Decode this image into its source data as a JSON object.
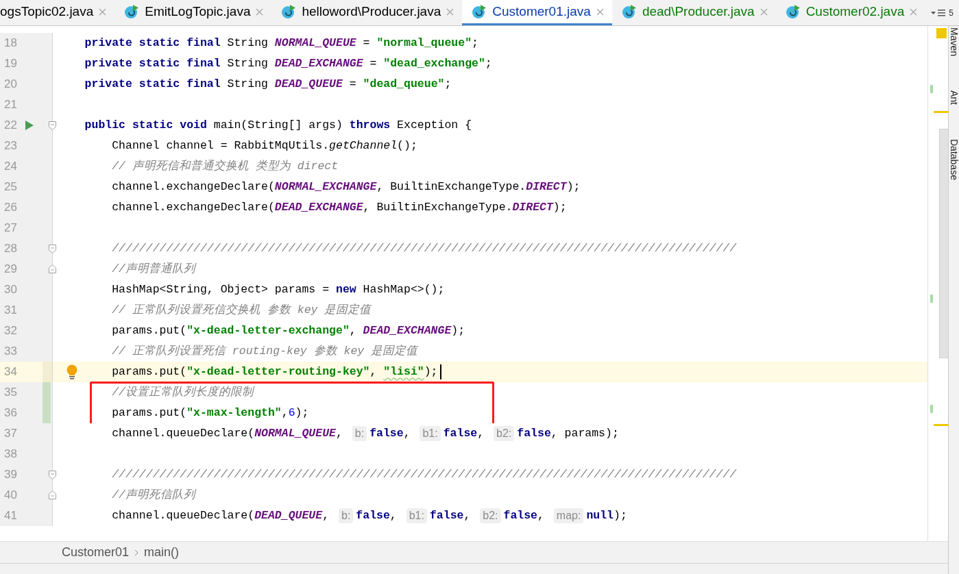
{
  "tabs": [
    {
      "label": "ogsTopic02.java",
      "selected": false,
      "has_icon": false,
      "color": "#000000"
    },
    {
      "label": "EmitLogTopic.java",
      "selected": false,
      "has_icon": true,
      "color": "#000000"
    },
    {
      "label": "helloword\\Producer.java",
      "selected": false,
      "has_icon": true,
      "color": "#000000"
    },
    {
      "label": "Customer01.java",
      "selected": true,
      "has_icon": true,
      "color": "#0b3aa8"
    },
    {
      "label": "dead\\Producer.java",
      "selected": false,
      "has_icon": true,
      "color": "#0a7a0a"
    },
    {
      "label": "Customer02.java",
      "selected": false,
      "has_icon": true,
      "color": "#0a7a0a"
    }
  ],
  "tab_overflow": "5",
  "lines": [
    {
      "number": "18",
      "current": false,
      "changed": false,
      "boxed": false,
      "tokens": [
        {
          "kind": "keyword",
          "text": "    private static final "
        },
        {
          "kind": "plain",
          "text": "String "
        },
        {
          "kind": "constant",
          "text": "NORMAL_QUEUE"
        },
        {
          "kind": "plain",
          "text": " = "
        },
        {
          "kind": "string",
          "text": "\"normal_queue\""
        },
        {
          "kind": "plain",
          "text": ";"
        }
      ]
    },
    {
      "number": "19",
      "current": false,
      "changed": false,
      "boxed": false,
      "tokens": [
        {
          "kind": "keyword",
          "text": "    private static final "
        },
        {
          "kind": "plain",
          "text": "String "
        },
        {
          "kind": "constant",
          "text": "DEAD_EXCHANGE"
        },
        {
          "kind": "plain",
          "text": " = "
        },
        {
          "kind": "string",
          "text": "\"dead_exchange\""
        },
        {
          "kind": "plain",
          "text": ";"
        }
      ]
    },
    {
      "number": "20",
      "current": false,
      "changed": false,
      "boxed": false,
      "tokens": [
        {
          "kind": "keyword",
          "text": "    private static final "
        },
        {
          "kind": "plain",
          "text": "String "
        },
        {
          "kind": "constant",
          "text": "DEAD_QUEUE"
        },
        {
          "kind": "plain",
          "text": " = "
        },
        {
          "kind": "string",
          "text": "\"dead_queue\""
        },
        {
          "kind": "plain",
          "text": ";"
        }
      ]
    },
    {
      "number": "21",
      "current": false,
      "changed": false,
      "boxed": false
    },
    {
      "number": "22",
      "gutter_icons": [
        {
          "kind": "run"
        },
        {
          "kind": "fold_start"
        }
      ],
      "current": false,
      "changed": false,
      "boxed": false,
      "tokens": [
        {
          "kind": "keyword",
          "text": "    public static void "
        },
        {
          "kind": "plain",
          "text": "main(String[] args) "
        },
        {
          "kind": "keyword",
          "text": "throws "
        },
        {
          "kind": "plain",
          "text": "Exception {"
        }
      ]
    },
    {
      "number": "23",
      "current": false,
      "changed": false,
      "boxed": false,
      "tokens": [
        {
          "kind": "plain",
          "text": "        Channel channel = RabbitMqUtils."
        },
        {
          "kind": "static_call",
          "text": "getChannel"
        },
        {
          "kind": "plain",
          "text": "();"
        }
      ]
    },
    {
      "number": "24",
      "current": false,
      "changed": false,
      "boxed": false,
      "tokens": [
        {
          "kind": "comment",
          "text": "        // 声明死信和普通交换机 类型为 direct"
        }
      ]
    },
    {
      "number": "25",
      "current": false,
      "changed": false,
      "boxed": false,
      "tokens": [
        {
          "kind": "plain",
          "text": "        channel.exchangeDeclare("
        },
        {
          "kind": "constant",
          "text": "NORMAL_EXCHANGE"
        },
        {
          "kind": "plain",
          "text": ", BuiltinExchangeType."
        },
        {
          "kind": "constant",
          "text": "DIRECT"
        },
        {
          "kind": "plain",
          "text": ");"
        }
      ]
    },
    {
      "number": "26",
      "current": false,
      "changed": false,
      "boxed": false,
      "tokens": [
        {
          "kind": "plain",
          "text": "        channel.exchangeDeclare("
        },
        {
          "kind": "constant",
          "text": "DEAD_EXCHANGE"
        },
        {
          "kind": "plain",
          "text": ", BuiltinExchangeType."
        },
        {
          "kind": "constant",
          "text": "DIRECT"
        },
        {
          "kind": "plain",
          "text": ");"
        }
      ]
    },
    {
      "number": "27",
      "current": false,
      "changed": false,
      "boxed": false
    },
    {
      "number": "28",
      "gutter_icons": [
        {
          "kind": "fold_start"
        }
      ],
      "current": false,
      "changed": false,
      "boxed": false,
      "tokens": [
        {
          "kind": "comment",
          "text": "        ////////////////////////////////////////////////////////////////////////////////////////////"
        }
      ]
    },
    {
      "number": "29",
      "gutter_icons": [
        {
          "kind": "fold_end"
        }
      ],
      "current": false,
      "changed": false,
      "boxed": false,
      "tokens": [
        {
          "kind": "comment",
          "text": "        //声明普通队列"
        }
      ]
    },
    {
      "number": "30",
      "current": false,
      "changed": false,
      "boxed": false,
      "tokens": [
        {
          "kind": "plain",
          "text": "        HashMap<String, Object> params = "
        },
        {
          "kind": "keyword",
          "text": "new "
        },
        {
          "kind": "plain",
          "text": "HashMap<>();"
        }
      ]
    },
    {
      "number": "31",
      "current": false,
      "changed": false,
      "boxed": false,
      "tokens": [
        {
          "kind": "comment",
          "text": "        // 正常队列设置死信交换机 参数 key 是固定值"
        }
      ]
    },
    {
      "number": "32",
      "current": false,
      "changed": false,
      "boxed": false,
      "tokens": [
        {
          "kind": "plain",
          "text": "        params.put("
        },
        {
          "kind": "string",
          "text": "\"x-dead-letter-exchange\""
        },
        {
          "kind": "plain",
          "text": ", "
        },
        {
          "kind": "constant",
          "text": "DEAD_EXCHANGE"
        },
        {
          "kind": "plain",
          "text": ");"
        }
      ]
    },
    {
      "number": "33",
      "current": false,
      "changed": false,
      "boxed": false,
      "tokens": [
        {
          "kind": "comment",
          "text": "        // 正常队列设置死信 routing-key 参数 key 是固定值"
        }
      ]
    },
    {
      "number": "34",
      "gutter_icons": [
        {
          "kind": "bulb"
        }
      ],
      "current": true,
      "changed": false,
      "boxed": false,
      "tokens": [
        {
          "kind": "plain",
          "text": "        params.put("
        },
        {
          "kind": "string",
          "text": "\"x-dead-letter-routing-key\""
        },
        {
          "kind": "plain",
          "text": ", "
        },
        {
          "kind": "string_typo",
          "text": "\"lisi\""
        },
        {
          "kind": "plain",
          "text": ");"
        }
      ]
    },
    {
      "number": "35",
      "current": false,
      "changed": true,
      "boxed": true,
      "tokens": [
        {
          "kind": "comment",
          "text": "        //设置正常队列长度的限制"
        }
      ]
    },
    {
      "number": "36",
      "current": false,
      "changed": true,
      "boxed": true,
      "tokens": [
        {
          "kind": "plain",
          "text": "        params.put("
        },
        {
          "kind": "string",
          "text": "\"x-max-length\""
        },
        {
          "kind": "plain",
          "text": ","
        },
        {
          "kind": "number",
          "text": "6"
        },
        {
          "kind": "plain",
          "text": ");"
        }
      ]
    },
    {
      "number": "37",
      "current": false,
      "changed": false,
      "boxed": false,
      "tokens": [
        {
          "kind": "plain",
          "text": "        channel.queueDeclare("
        },
        {
          "kind": "constant",
          "text": "NORMAL_QUEUE"
        },
        {
          "kind": "plain",
          "text": ", "
        },
        {
          "kind": "hint",
          "text": "b:"
        },
        {
          "kind": "keyword",
          "text": "false"
        },
        {
          "kind": "plain",
          "text": ", "
        },
        {
          "kind": "hint",
          "text": "b1:"
        },
        {
          "kind": "keyword",
          "text": "false"
        },
        {
          "kind": "plain",
          "text": ", "
        },
        {
          "kind": "hint",
          "text": "b2:"
        },
        {
          "kind": "keyword",
          "text": "false"
        },
        {
          "kind": "plain",
          "text": ", params);"
        }
      ]
    },
    {
      "number": "38",
      "current": false,
      "changed": false,
      "boxed": false
    },
    {
      "number": "39",
      "gutter_icons": [
        {
          "kind": "fold_start"
        }
      ],
      "current": false,
      "changed": false,
      "boxed": false,
      "tokens": [
        {
          "kind": "comment",
          "text": "        ////////////////////////////////////////////////////////////////////////////////////////////"
        }
      ]
    },
    {
      "number": "40",
      "gutter_icons": [
        {
          "kind": "fold_end"
        }
      ],
      "current": false,
      "changed": false,
      "boxed": false,
      "tokens": [
        {
          "kind": "comment",
          "text": "        //声明死信队列"
        }
      ]
    },
    {
      "number": "41",
      "current": false,
      "changed": false,
      "boxed": false,
      "tokens": [
        {
          "kind": "plain",
          "text": "        channel.queueDeclare("
        },
        {
          "kind": "constant",
          "text": "DEAD_QUEUE"
        },
        {
          "kind": "plain",
          "text": ", "
        },
        {
          "kind": "hint",
          "text": "b:"
        },
        {
          "kind": "keyword",
          "text": "false"
        },
        {
          "kind": "plain",
          "text": ", "
        },
        {
          "kind": "hint",
          "text": "b1:"
        },
        {
          "kind": "keyword",
          "text": "false"
        },
        {
          "kind": "plain",
          "text": ", "
        },
        {
          "kind": "hint",
          "text": "b2:"
        },
        {
          "kind": "keyword",
          "text": "false"
        },
        {
          "kind": "plain",
          "text": ", "
        },
        {
          "kind": "hint",
          "text": "map:"
        },
        {
          "kind": "keyword",
          "text": "null"
        },
        {
          "kind": "plain",
          "text": ");"
        }
      ]
    }
  ],
  "breadcrumbs": [
    "Customer01",
    "main()"
  ],
  "tool_windows": [
    "Maven",
    "Ant",
    "Database"
  ]
}
